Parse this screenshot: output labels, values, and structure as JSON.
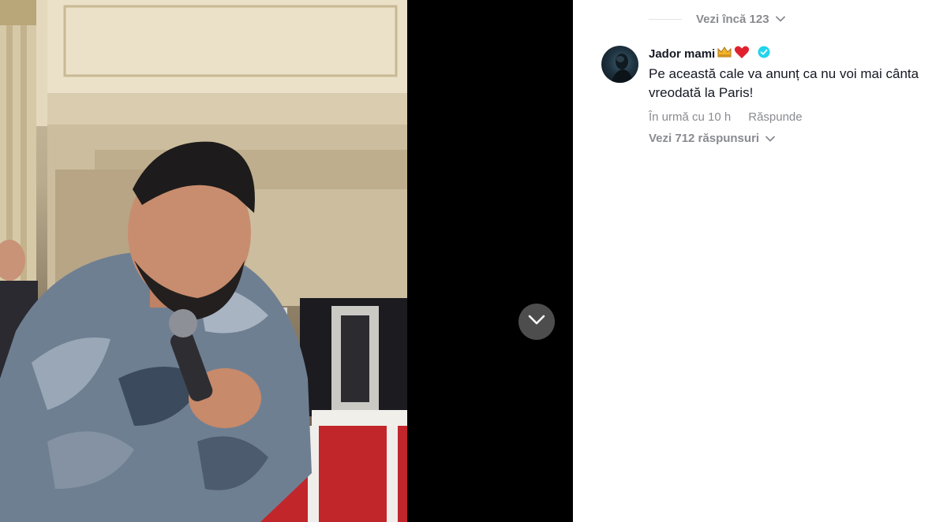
{
  "comments": {
    "view_more_label": "Vezi încă 123",
    "item": {
      "username": "Jador mami",
      "badges": [
        "crown-emoji",
        "heart-emoji",
        "verified-badge"
      ],
      "text_line1": "Pe această cale va anunț ca nu voi mai cânta",
      "text_line2": "vreodată la Paris!",
      "timestamp": "În urmă cu 10 h",
      "reply_label": "Răspunde",
      "view_replies_label": "Vezi 712 răspunsuri"
    }
  },
  "colors": {
    "muted_text": "#8a8b91",
    "primary_text": "#161823",
    "verified": "#20d5ec",
    "heart": "#e0202f",
    "crown": "#f2b42a",
    "collapse_button": "#545454"
  }
}
